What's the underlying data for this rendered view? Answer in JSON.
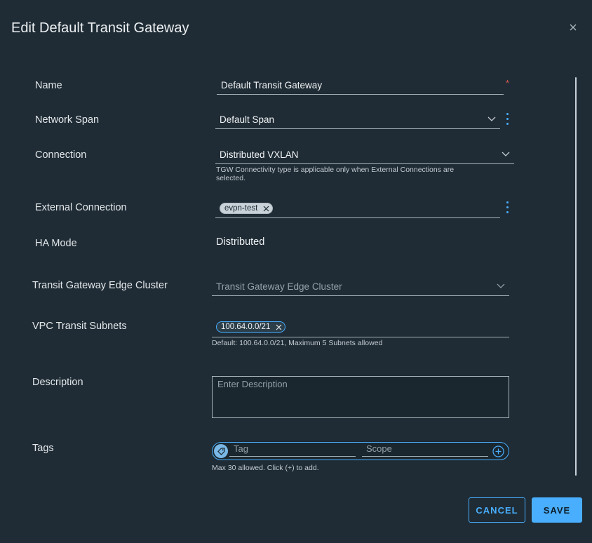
{
  "dialog": {
    "title": "Edit Default Transit Gateway"
  },
  "form": {
    "name": {
      "label": "Name",
      "value": "Default Transit Gateway",
      "required_mark": "*"
    },
    "network_span": {
      "label": "Network Span",
      "value": "Default Span"
    },
    "connection": {
      "label": "Connection",
      "value": "Distributed VXLAN",
      "helper_line1": "TGW Connectivity type is applicable only when External Connections are",
      "helper_line2": "selected."
    },
    "external_connection": {
      "label": "External Connection",
      "chips": [
        "evpn-test"
      ]
    },
    "ha_mode": {
      "label": "HA Mode",
      "value": "Distributed"
    },
    "edge_cluster": {
      "label": "Transit Gateway Edge Cluster",
      "placeholder": "Transit Gateway Edge Cluster"
    },
    "vpc_transit_subnets": {
      "label": "VPC Transit Subnets",
      "chips": [
        "100.64.0.0/21"
      ],
      "helper": "Default: 100.64.0.0/21, Maximum 5 Subnets allowed"
    },
    "description": {
      "label": "Description",
      "placeholder": "Enter Description"
    },
    "tags": {
      "label": "Tags",
      "tag_placeholder": "Tag",
      "scope_placeholder": "Scope",
      "helper": "Max 30 allowed. Click (+) to add."
    }
  },
  "actions": {
    "cancel": "CANCEL",
    "save": "SAVE"
  },
  "colors": {
    "background": "#1f2c35",
    "accent": "#49aefd",
    "required": "#e05a4f"
  }
}
